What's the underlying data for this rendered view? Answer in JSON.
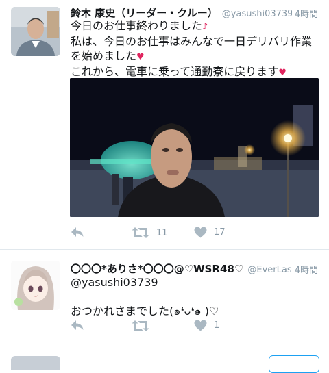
{
  "tweets": [
    {
      "name": "鈴木 康史（リーダー・クルー）",
      "handle": "@yasushi03739",
      "time": "4時間",
      "text_line1": "今日のお仕事終わりました",
      "text_line2": "私は、今日のお仕事はみんなで一日デリバリ作業を始めました",
      "text_line3": "これから、電車に乗って通勤寮に戻ります",
      "emoji_note": "♪",
      "emoji_heart": "♥",
      "retweet_count": "11",
      "like_count": "17"
    },
    {
      "name": "〇〇〇*ありさ*〇〇〇@♡WSR48♡",
      "handle": "@EverLasting...",
      "time": "4時間",
      "reply_to": "@yasushi03739",
      "text": "おつかれさまでした(๑❛ᴗ❛๑ )♡",
      "like_count": "1"
    }
  ],
  "icons": {
    "reply": "reply-icon",
    "retweet": "retweet-icon",
    "like": "heart-icon"
  },
  "colors": {
    "icon": "#aab8c2",
    "meta": "#8899a6",
    "divider": "#e1e8ed",
    "accent": "#1da1f2"
  }
}
